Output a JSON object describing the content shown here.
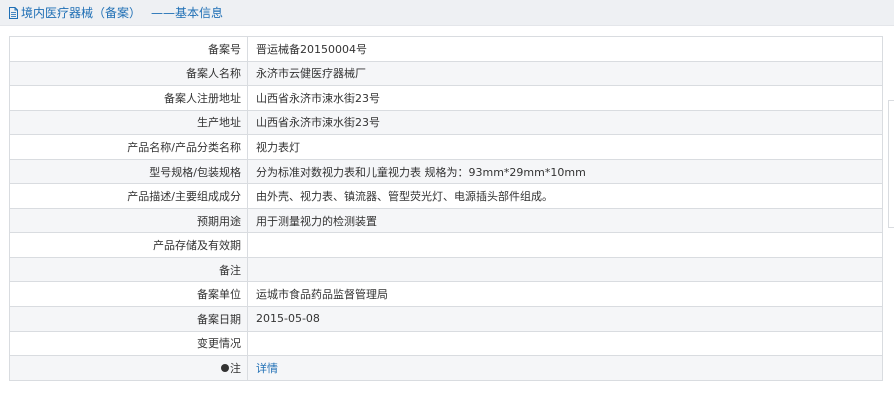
{
  "header": {
    "category": "境内医疗器械（备案）",
    "separator": "——基本信息",
    "icon": "document-icon"
  },
  "rows": [
    {
      "label": "备案号",
      "value": "晋运械备20150004号"
    },
    {
      "label": "备案人名称",
      "value": "永济市云健医疗器械厂"
    },
    {
      "label": "备案人注册地址",
      "value": "山西省永济市涑水街23号"
    },
    {
      "label": "生产地址",
      "value": "山西省永济市涑水街23号"
    },
    {
      "label": "产品名称/产品分类名称",
      "value": "视力表灯"
    },
    {
      "label": "型号规格/包装规格",
      "value": "分为标准对数视力表和儿童视力表 规格为：93mm*29mm*10mm"
    },
    {
      "label": "产品描述/主要组成成分",
      "value": "由外壳、视力表、镇流器、管型荧光灯、电源插头部件组成。"
    },
    {
      "label": "预期用途",
      "value": "用于测量视力的检测装置"
    },
    {
      "label": "产品存储及有效期",
      "value": ""
    },
    {
      "label": "备注",
      "value": ""
    },
    {
      "label": "备案单位",
      "value": "运城市食品药品监督管理局"
    },
    {
      "label": "备案日期",
      "value": "2015-05-08"
    },
    {
      "label": "变更情况",
      "value": ""
    }
  ],
  "note_row": {
    "icon": "bullet-icon",
    "label": "注",
    "link_text": "详情"
  },
  "colors": {
    "link": "#1f6fb5",
    "header_bg": "#eef0f3",
    "border": "#d9dce0",
    "alt_row": "#f5f6f8"
  }
}
